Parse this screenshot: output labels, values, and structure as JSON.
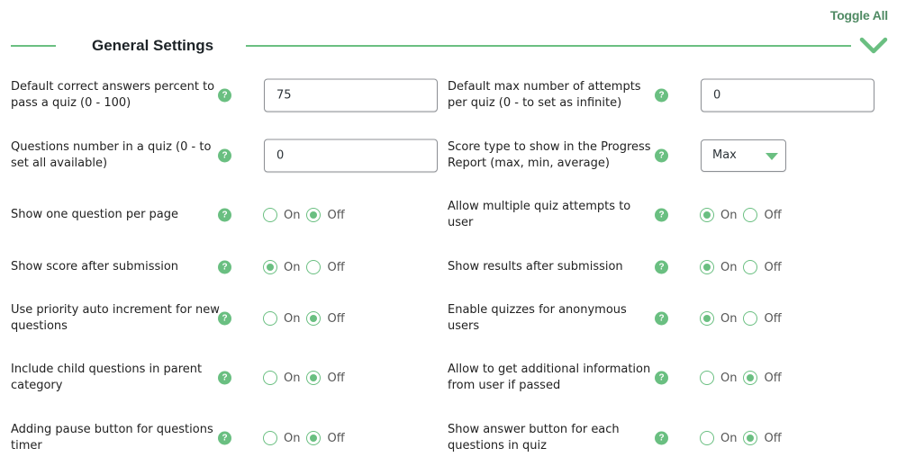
{
  "header": {
    "toggle_all": "Toggle All",
    "section_title": "General Settings",
    "accent_color": "#6abf81"
  },
  "left_settings": [
    {
      "label": "Default correct answers percent to pass a quiz (0 - 100)",
      "type": "text",
      "value": "75"
    },
    {
      "label": "Questions number in a quiz (0 - to set all available)",
      "type": "text",
      "value": "0"
    },
    {
      "label": "Show one question per page",
      "type": "radio",
      "selected": "Off"
    },
    {
      "label": "Show score after submission",
      "type": "radio",
      "selected": "On"
    },
    {
      "label": "Use priority auto increment for new questions",
      "type": "radio",
      "selected": "Off"
    },
    {
      "label": "Include child questions in parent category",
      "type": "radio",
      "selected": "Off"
    },
    {
      "label": "Adding pause button for questions timer",
      "type": "radio",
      "selected": "Off"
    }
  ],
  "right_settings": [
    {
      "label": "Default max number of attempts per quiz (0 - to set as infinite)",
      "type": "text",
      "value": "0"
    },
    {
      "label": "Score type to show in the Progress Report (max, min, average)",
      "type": "select",
      "value": "Max"
    },
    {
      "label": "Allow multiple quiz attempts to user",
      "type": "radio",
      "selected": "On"
    },
    {
      "label": "Show results after submission",
      "type": "radio",
      "selected": "On"
    },
    {
      "label": "Enable quizzes for anonymous users",
      "type": "radio",
      "selected": "On"
    },
    {
      "label": "Allow to get additional information from user if passed",
      "type": "radio",
      "selected": "Off"
    },
    {
      "label": "Show answer button for each questions in quiz",
      "type": "radio",
      "selected": "Off"
    }
  ],
  "radio_options": {
    "on": "On",
    "off": "Off"
  },
  "help_icon_glyph": "?"
}
